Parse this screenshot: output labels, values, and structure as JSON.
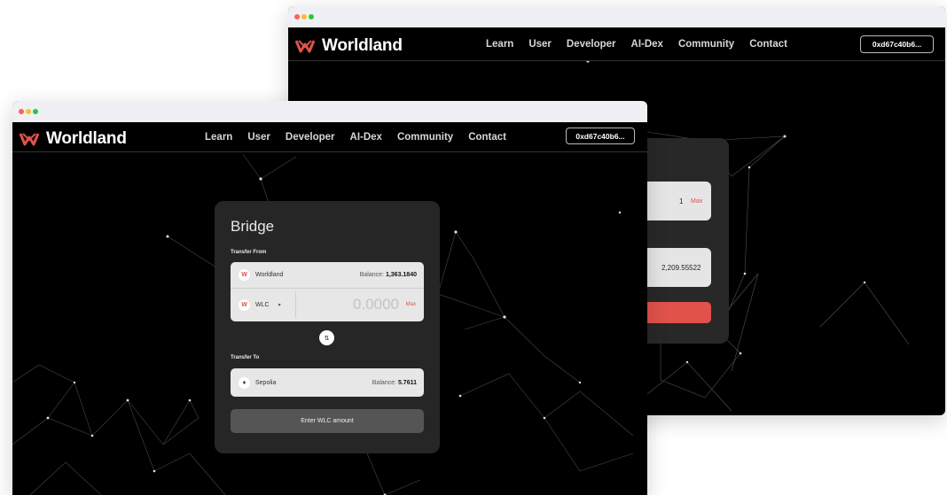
{
  "brand": {
    "name": "Worldland",
    "accent": "#e0524a"
  },
  "nav": {
    "links": [
      "Learn",
      "User",
      "Developer",
      "AI-Dex",
      "Community",
      "Contact"
    ],
    "wallet": "0xd67c40b6..."
  },
  "back_window": {
    "top_value": "1",
    "max_label": "Max",
    "balance_value": "2,209.55522"
  },
  "bridge": {
    "title": "Bridge",
    "transfer_from_label": "Transfer From",
    "from_network": "Worldland",
    "from_balance_label": "Balance:",
    "from_balance_value": "1,363.1840",
    "token": "WLC",
    "amount": "0.0000",
    "max_label": "Max",
    "transfer_to_label": "Transfer To",
    "to_network": "Sepolia",
    "to_balance_label": "Balance:",
    "to_balance_value": "5.7611",
    "submit_label": "Enter WLC amount"
  },
  "icons": {
    "logo": "worldland-logo-icon",
    "swap": "swap-arrows-icon",
    "network_from": "worldland-icon",
    "network_to": "ethereum-icon",
    "dropdown": "chevron-down-icon"
  }
}
